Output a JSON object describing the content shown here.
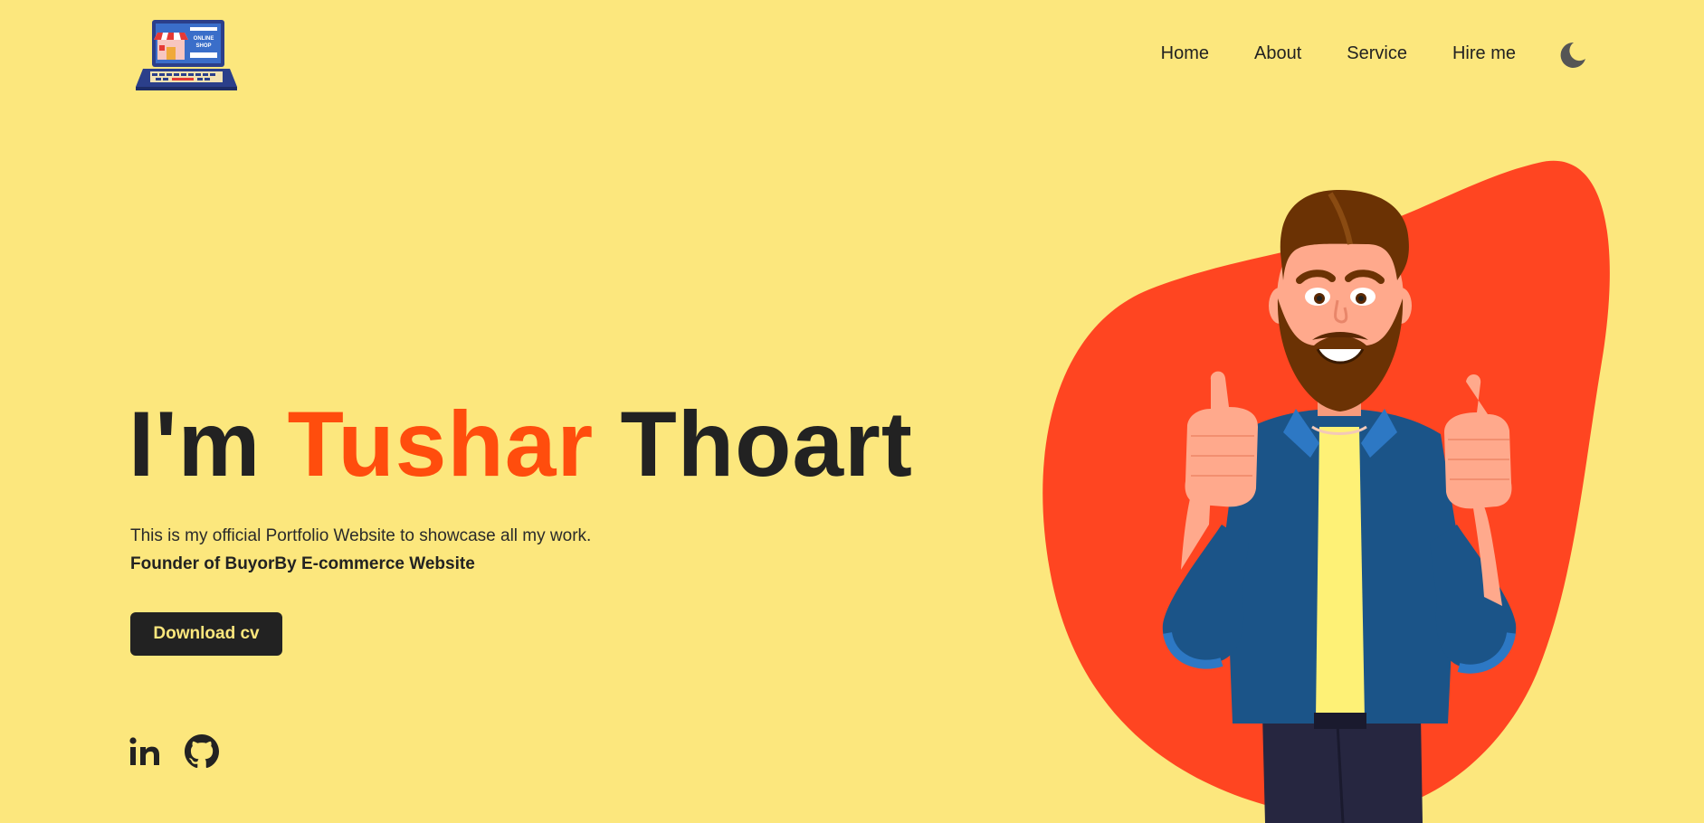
{
  "brand": {
    "logo_text": "ONLINE SHOP"
  },
  "nav": {
    "items": [
      "Home",
      "About",
      "Service",
      "Hire me"
    ],
    "theme_icon": "moon-icon"
  },
  "hero": {
    "title_prefix": "I'm ",
    "title_accent": "Tushar",
    "title_suffix": " Thoart",
    "description": "This is my official Portfolio Website to showcase all my work.",
    "founder": "Founder of BuyorBy E-commerce Website",
    "cv_button": "Download cv"
  },
  "social": {
    "icons": [
      "linkedin-icon",
      "github-icon"
    ]
  },
  "colors": {
    "background": "#fce77d",
    "accent": "#ff4d0d",
    "dark": "#222222",
    "blob": "#ff4521"
  }
}
